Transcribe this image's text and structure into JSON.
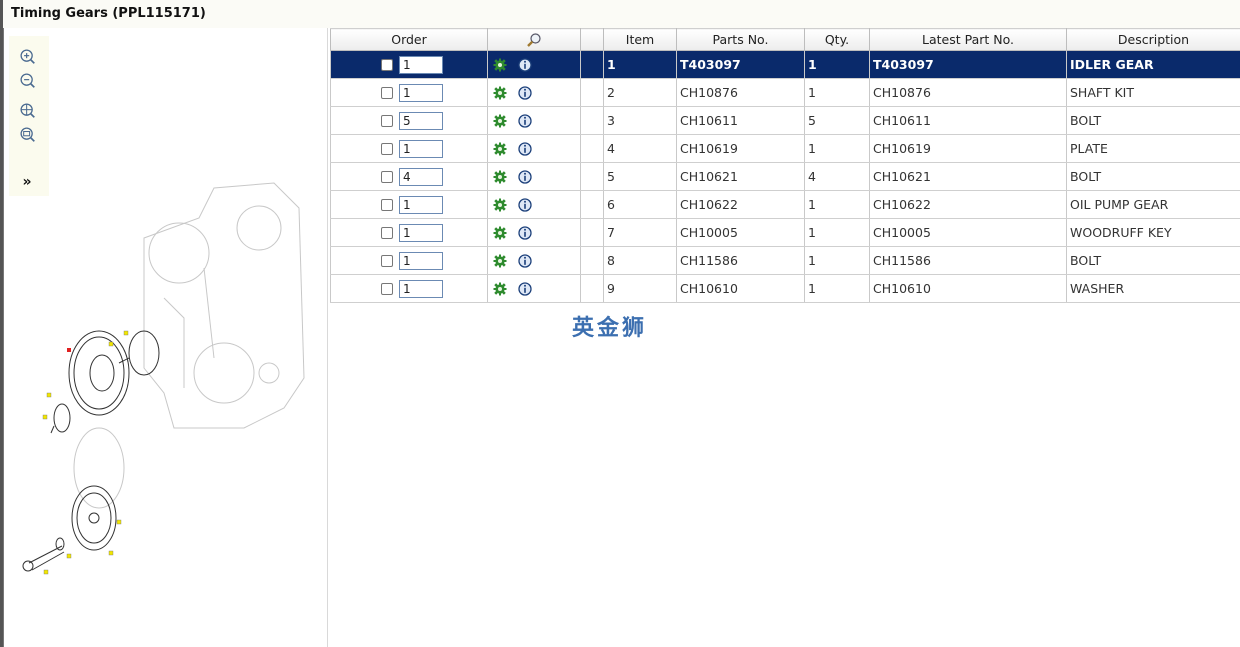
{
  "window": {
    "title": "Timing Gears (PPL115171)"
  },
  "toolbar": {
    "tools": [
      "zoom-in-icon",
      "zoom-out-icon",
      "zoom-fit-icon",
      "zoom-window-icon"
    ],
    "expand_label": "»"
  },
  "table": {
    "columns": {
      "order": "Order",
      "find": "",
      "blank": "",
      "item": "Item",
      "parts_no": "Parts No.",
      "qty": "Qty.",
      "latest_part_no": "Latest Part No.",
      "description": "Description"
    },
    "rows": [
      {
        "order_qty": "1",
        "item": "1",
        "parts_no": "T403097",
        "qty": "1",
        "latest": "T403097",
        "description": "IDLER GEAR"
      },
      {
        "order_qty": "1",
        "item": "2",
        "parts_no": "CH10876",
        "qty": "1",
        "latest": "CH10876",
        "description": "SHAFT KIT"
      },
      {
        "order_qty": "5",
        "item": "3",
        "parts_no": "CH10611",
        "qty": "5",
        "latest": "CH10611",
        "description": "BOLT"
      },
      {
        "order_qty": "1",
        "item": "4",
        "parts_no": "CH10619",
        "qty": "1",
        "latest": "CH10619",
        "description": "PLATE"
      },
      {
        "order_qty": "4",
        "item": "5",
        "parts_no": "CH10621",
        "qty": "4",
        "latest": "CH10621",
        "description": "BOLT"
      },
      {
        "order_qty": "1",
        "item": "6",
        "parts_no": "CH10622",
        "qty": "1",
        "latest": "CH10622",
        "description": "OIL PUMP GEAR"
      },
      {
        "order_qty": "1",
        "item": "7",
        "parts_no": "CH10005",
        "qty": "1",
        "latest": "CH10005",
        "description": "WOODRUFF KEY"
      },
      {
        "order_qty": "1",
        "item": "8",
        "parts_no": "CH11586",
        "qty": "1",
        "latest": "CH11586",
        "description": "BOLT"
      },
      {
        "order_qty": "1",
        "item": "9",
        "parts_no": "CH10610",
        "qty": "1",
        "latest": "CH10610",
        "description": "WASHER"
      }
    ]
  },
  "watermark": "英金狮",
  "colors": {
    "selected_row": "#0a2a6b",
    "header_bg": "#f2f2f2",
    "accent": "#3c6fb0"
  }
}
